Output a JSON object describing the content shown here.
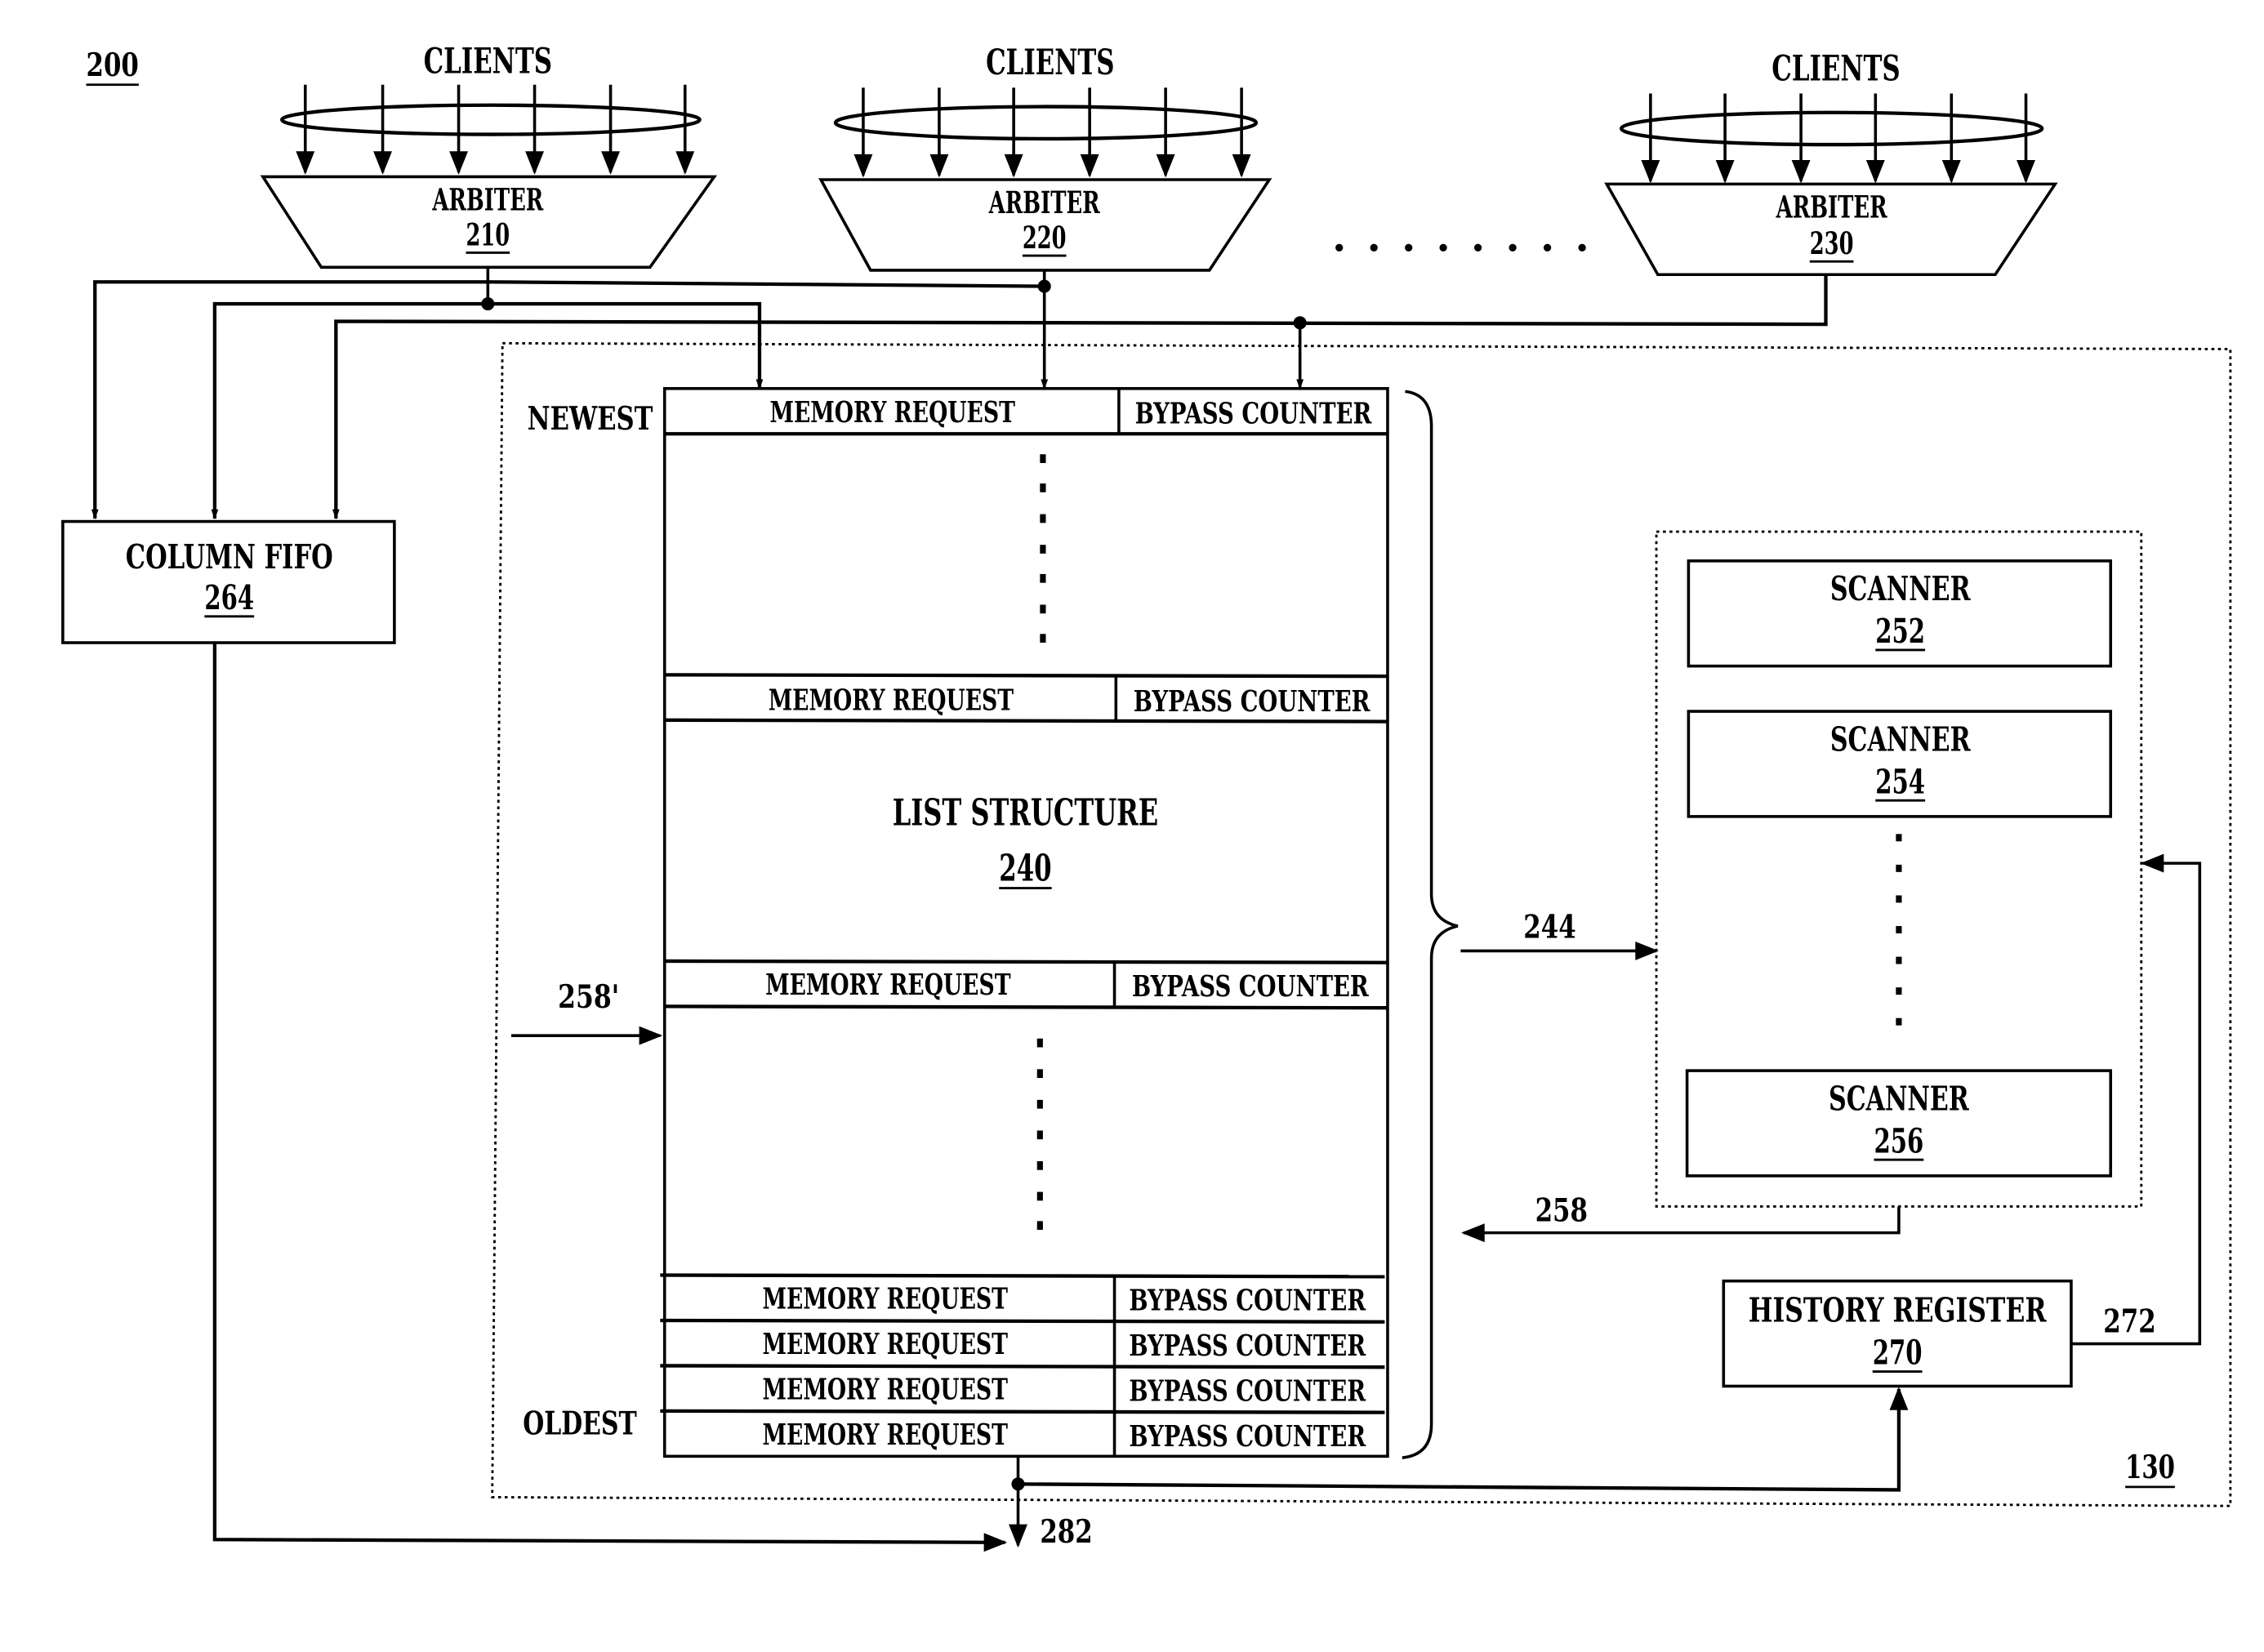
{
  "figure": {
    "ref": "200",
    "clients_label": "CLIENTS",
    "ellipsis": "........",
    "arbiters": [
      {
        "label": "ARBITER",
        "ref": "210"
      },
      {
        "label": "ARBITER",
        "ref": "220"
      },
      {
        "label": "ARBITER",
        "ref": "230"
      }
    ],
    "column_fifo": {
      "label": "COLUMN FIFO",
      "ref": "264"
    },
    "list_structure": {
      "label": "LIST STRUCTURE",
      "ref": "240",
      "newest_label": "NEWEST",
      "oldest_label": "OLDEST",
      "rows": [
        {
          "request": "MEMORY REQUEST",
          "counter": "BYPASS COUNTER"
        },
        {
          "request": "MEMORY REQUEST",
          "counter": "BYPASS COUNTER"
        },
        {
          "request": "MEMORY REQUEST",
          "counter": "BYPASS COUNTER"
        },
        {
          "request": "MEMORY REQUEST",
          "counter": "BYPASS COUNTER"
        },
        {
          "request": "MEMORY REQUEST",
          "counter": "BYPASS COUNTER"
        },
        {
          "request": "MEMORY REQUEST",
          "counter": "BYPASS COUNTER"
        },
        {
          "request": "MEMORY REQUEST",
          "counter": "BYPASS COUNTER"
        }
      ]
    },
    "scanners": [
      {
        "label": "SCANNER",
        "ref": "252"
      },
      {
        "label": "SCANNER",
        "ref": "254"
      },
      {
        "label": "SCANNER",
        "ref": "256"
      }
    ],
    "history_register": {
      "label": "HISTORY REGISTER",
      "ref": "270"
    },
    "signal_labels": {
      "s244": "244",
      "s258": "258",
      "s258p": "258'",
      "s272": "272",
      "s282": "282"
    },
    "controller_ref": "130"
  }
}
